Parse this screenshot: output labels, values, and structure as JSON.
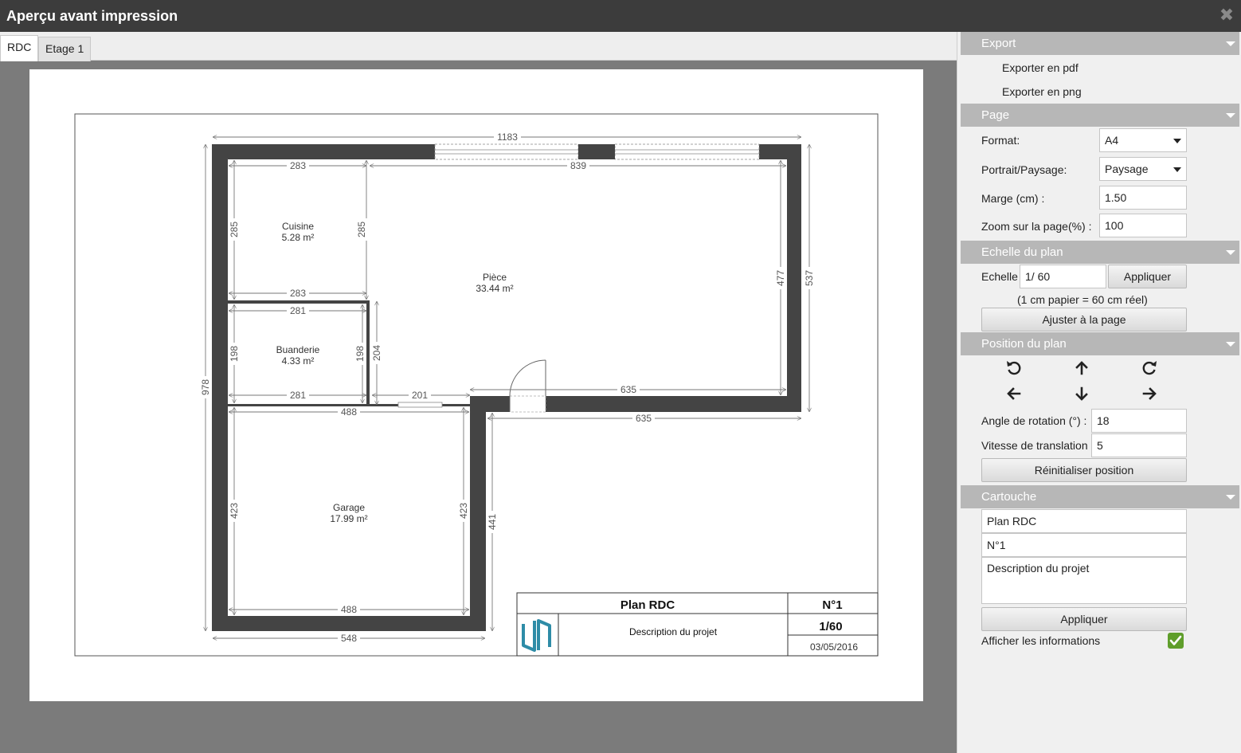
{
  "window": {
    "title": "Aperçu avant impression"
  },
  "tabs": [
    {
      "label": "RDC"
    },
    {
      "label": "Etage 1"
    }
  ],
  "plan": {
    "rooms": [
      {
        "name": "Cuisine",
        "area": "5.28 m²"
      },
      {
        "name": "Pièce",
        "area": "33.44 m²"
      },
      {
        "name": "Buanderie",
        "area": "4.33 m²"
      },
      {
        "name": "Garage",
        "area": "17.99 m²"
      }
    ],
    "dims": {
      "top_total": "1183",
      "cuisine_top": "283",
      "piece_top": "839",
      "cuisine_bottom": "283",
      "buanderie_top": "281",
      "buanderie_bottom": "281",
      "corridor": "201",
      "piece_bottom_inner": "635",
      "piece_bottom_outer": "635",
      "garage_top": "488",
      "garage_bottom": "488",
      "bottom_total": "548",
      "left_total": "978",
      "cuisine_left": "285",
      "cuisine_right": "285",
      "buanderie_left": "198",
      "buanderie_right": "198",
      "buanderie_outer": "204",
      "garage_left": "423",
      "garage_right": "423",
      "right_outer_lower": "441",
      "piece_right": "477",
      "right_total": "537"
    },
    "cartouche": {
      "title": "Plan RDC",
      "number": "N°1",
      "scale": "1/60",
      "description": "Description du projet",
      "date": "03/05/2016"
    }
  },
  "sidebar": {
    "export": {
      "header": "Export",
      "pdf": "Exporter en pdf",
      "png": "Exporter en png"
    },
    "page": {
      "header": "Page",
      "format_label": "Format:",
      "format_value": "A4",
      "orientation_label": "Portrait/Paysage:",
      "orientation_value": "Paysage",
      "margin_label": "Marge (cm) :",
      "margin_value": "1.50",
      "zoom_label": "Zoom sur la page(%) :",
      "zoom_value": "100"
    },
    "scale": {
      "header": "Echelle du plan",
      "label": "Echelle",
      "value": "1/ 60",
      "apply": "Appliquer",
      "note": "(1 cm papier = 60 cm réel)",
      "fit": "Ajuster à la page"
    },
    "position": {
      "header": "Position du plan",
      "angle_label": "Angle de rotation (°) :",
      "angle_value": "18",
      "speed_label": "Vitesse de translation",
      "speed_value": "5",
      "reset": "Réinitialiser position"
    },
    "cartouche": {
      "header": "Cartouche",
      "title_value": "Plan RDC",
      "number_value": "N°1",
      "description_value": "Description du projet",
      "apply": "Appliquer",
      "show_info_label": "Afficher les informations",
      "show_info_checked": true
    }
  },
  "colors": {
    "wall": "#444444",
    "accent_logo": "#2e8ca7",
    "check": "#5f9e2b"
  }
}
